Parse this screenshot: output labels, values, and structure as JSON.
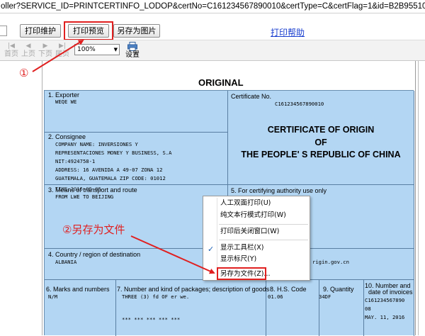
{
  "url_text": "oller?SERVICE_ID=PRINTCERTINFO_LODOP&certNo=C161234567890010&certType=C&certFlag=1&id=B2B955100AF004183375E0DA09F",
  "toolbar": {
    "print_maintain": "打印维护",
    "print_preview": "打印预览",
    "save_as_image": "另存为图片",
    "print_help": "打印帮助"
  },
  "nav": {
    "first": "首页",
    "prev": "上页",
    "next": "下页",
    "last": "尾页",
    "zoom": "100%",
    "settings": "设置"
  },
  "annotations": {
    "step1": "①",
    "step2": "②另存为文件"
  },
  "colors": {
    "form_bg": "#b3d6f3",
    "highlight": "#e02020",
    "link": "#1a3fcf"
  },
  "document": {
    "original": "ORIGINAL",
    "exporter_label": "1. Exporter",
    "exporter_value": "WEQE WE",
    "cert_no_label": "Certificate No.",
    "cert_no_value": "C161234567890010",
    "cert_title_1": "CERTIFICATE OF ORIGIN",
    "cert_title_2": "OF",
    "cert_title_3": "THE PEOPLE' S REPUBLIC OF CHINA",
    "consignee_label": "2. Consignee",
    "consignee_lines": [
      "COMPANY NAME: INVERSIONES Y",
      "REPRESENTACIONES MONEY Y BUSINESS, S.A",
      "NIT:4924758-1",
      "ADDRESS: 16 AVENIDA A 49-07 ZONA 12",
      "GUATEMALA, GUATEMALA ZIP CODE: 01012"
    ],
    "transport_label": "3. Means of transport and route",
    "transport_overlap": "TIME:2016-05-05",
    "transport_route": "FROM LWE TO BEIJING",
    "authority_label": "5. For certifying authority use only",
    "website_partial": "rigin.gov.cn",
    "country_label": "4. Country / region of destination",
    "country_value": "ALBANIA",
    "marks_label": "6. Marks and numbers",
    "marks_value": "N/M",
    "goods_label": "7. Number and kind of packages; description of goods",
    "goods_value": "THREE (3) fd OF er we.",
    "goods_stars": "*** *** *** *** ***",
    "hs_label": "8. H.S. Code",
    "hs_value": "01.06",
    "qty_label": "9. Quantity",
    "qty_value": "34DF",
    "inv_label_1": "10. Number and",
    "inv_label_2": "date of invoices",
    "inv_value_1": "C161234567890",
    "inv_value_2": "08",
    "inv_value_3": "MAY. 11, 2016"
  },
  "context_menu": {
    "items": [
      "人工双面打印(U)",
      "纯文本行模式打印(W)",
      "打印后关闭窗口(W)",
      "显示工具栏(X)",
      "显示标尺(Y)",
      "另存为文件(Z)..."
    ]
  }
}
